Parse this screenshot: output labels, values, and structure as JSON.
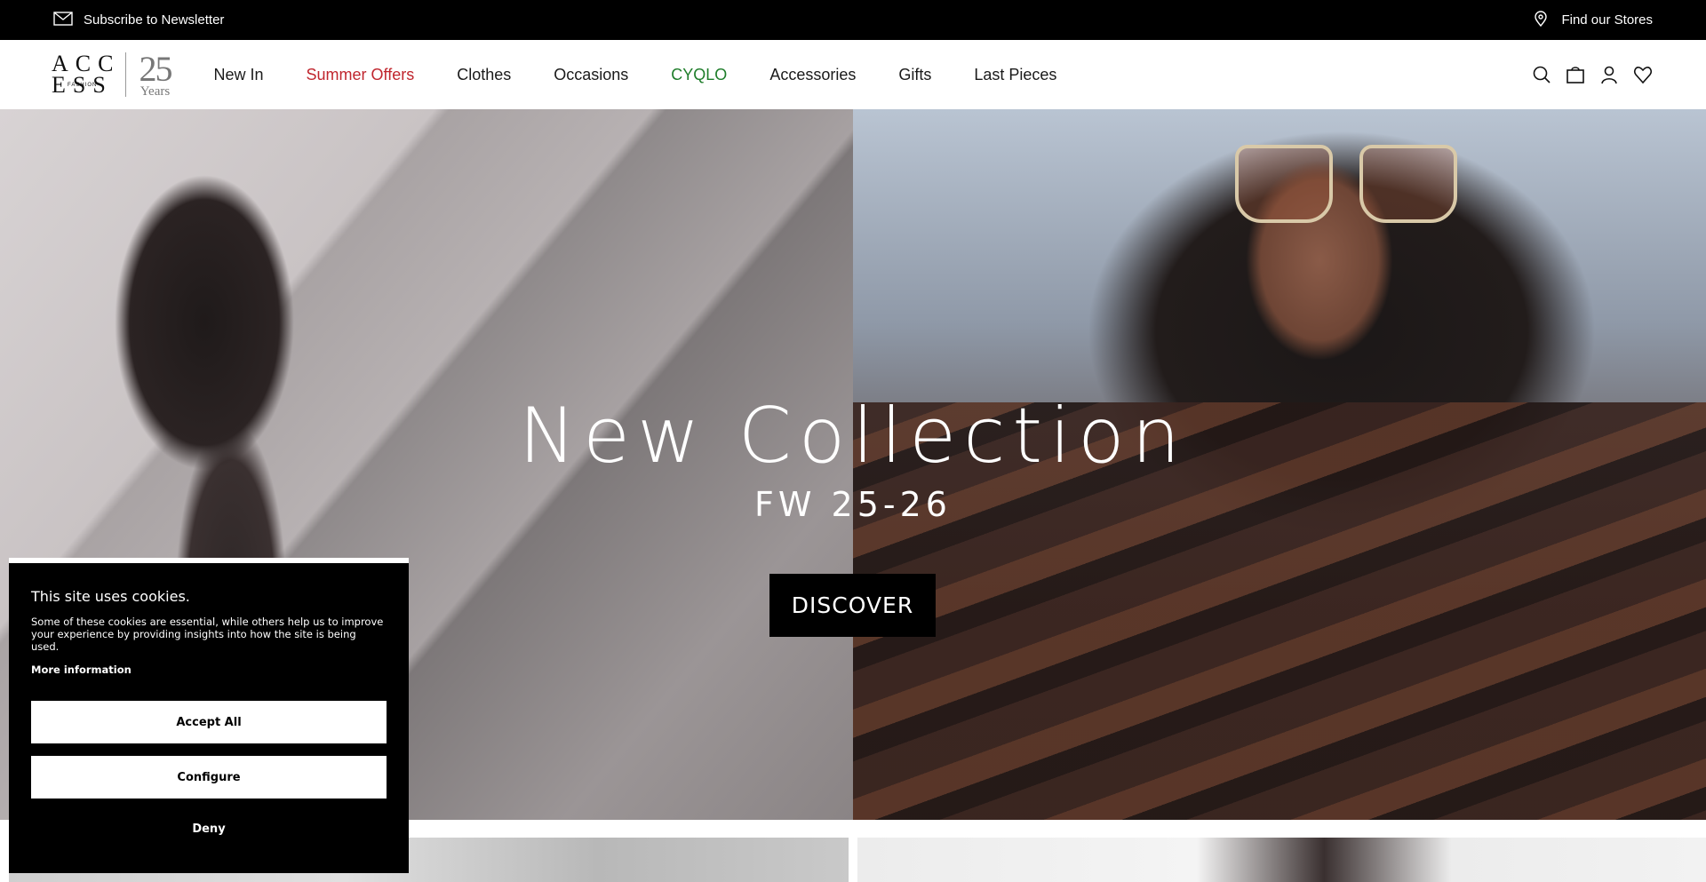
{
  "topbar": {
    "newsletter_label": "Subscribe to Newsletter",
    "stores_label": "Find our Stores"
  },
  "logo": {
    "brand_line1": "ACC",
    "brand_line2": "ESS",
    "brand_small": "FASHION",
    "years_number": "25",
    "years_label": "Years"
  },
  "nav": {
    "items": [
      {
        "label": "New In"
      },
      {
        "label": "Summer Offers"
      },
      {
        "label": "Clothes"
      },
      {
        "label": "Occasions"
      },
      {
        "label": "CYQLO"
      },
      {
        "label": "Accessories"
      },
      {
        "label": "Gifts"
      },
      {
        "label": "Last Pieces"
      }
    ],
    "icons": [
      "search-icon",
      "shopping-bag-icon",
      "account-icon",
      "wishlist-heart-icon"
    ]
  },
  "hero": {
    "title": "New Collection",
    "subtitle": "FW 25-26",
    "cta_label": "DISCOVER"
  },
  "cookie": {
    "title": "This site uses cookies.",
    "body": "Some of these cookies are essential, while others help us to improve your experience by providing insights into how the site is being used.",
    "more_label": "More information",
    "accept_label": "Accept All",
    "configure_label": "Configure",
    "deny_label": "Deny"
  },
  "colors": {
    "topbar_bg": "#000000",
    "summer_offers": "#c0262e",
    "cyqlo": "#1e7d2a",
    "cookie_bg": "#000000"
  }
}
